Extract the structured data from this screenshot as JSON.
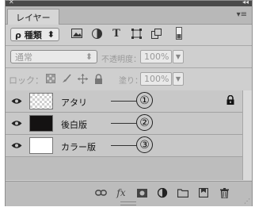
{
  "window": {
    "close_glyph": "✕",
    "collapse_glyph": "◂◂"
  },
  "tab": {
    "label": "レイヤー",
    "close_glyph": "×",
    "menu_glyph": "▾≡"
  },
  "filter": {
    "label": "ρ 種類",
    "arrow": "⬍",
    "icons": [
      "image-filter-icon",
      "adjustment-filter-icon",
      "type-filter-icon",
      "shape-filter-icon",
      "smart-object-filter-icon",
      "filter-toggle-icon"
    ]
  },
  "blend": {
    "mode": "通常",
    "opacity_label": "不透明度：",
    "opacity_value": "100%"
  },
  "lock": {
    "label": "ロック：",
    "fill_label": "塗り：",
    "fill_value": "100%"
  },
  "layers": [
    {
      "name": "アタリ",
      "annotation": "①",
      "thumb": "transparent",
      "locked": true
    },
    {
      "name": "後白版",
      "annotation": "②",
      "thumb": "#111111",
      "locked": false
    },
    {
      "name": "カラー版",
      "annotation": "③",
      "thumb": "#ffffff",
      "locked": false
    }
  ],
  "footer_icons": [
    "link-icon",
    "fx-icon",
    "mask-icon",
    "adjustment-icon",
    "folder-icon",
    "new-layer-icon",
    "trash-icon"
  ]
}
